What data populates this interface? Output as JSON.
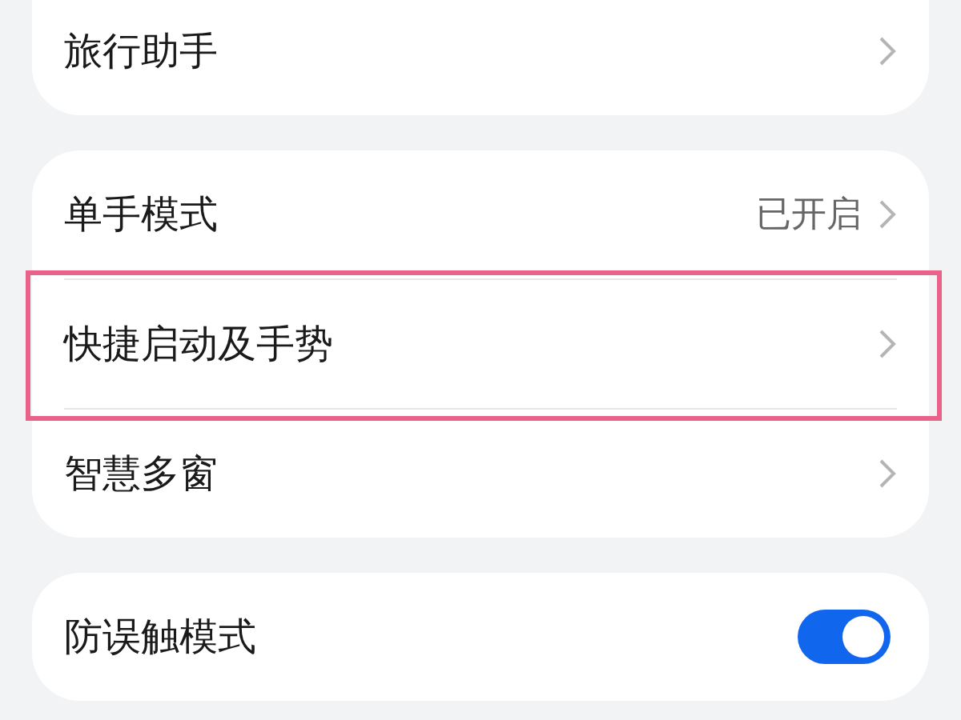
{
  "groups": [
    {
      "items": [
        {
          "kind": "link",
          "label": "旅行助手",
          "highlighted": false
        }
      ]
    },
    {
      "items": [
        {
          "kind": "link",
          "label": "单手模式",
          "value": "已开启",
          "highlighted": false
        },
        {
          "kind": "link",
          "label": "快捷启动及手势",
          "highlighted": true
        },
        {
          "kind": "link",
          "label": "智慧多窗",
          "highlighted": false
        }
      ]
    },
    {
      "items": [
        {
          "kind": "toggle",
          "label": "防误触模式",
          "on": true,
          "highlighted": false
        }
      ]
    }
  ]
}
